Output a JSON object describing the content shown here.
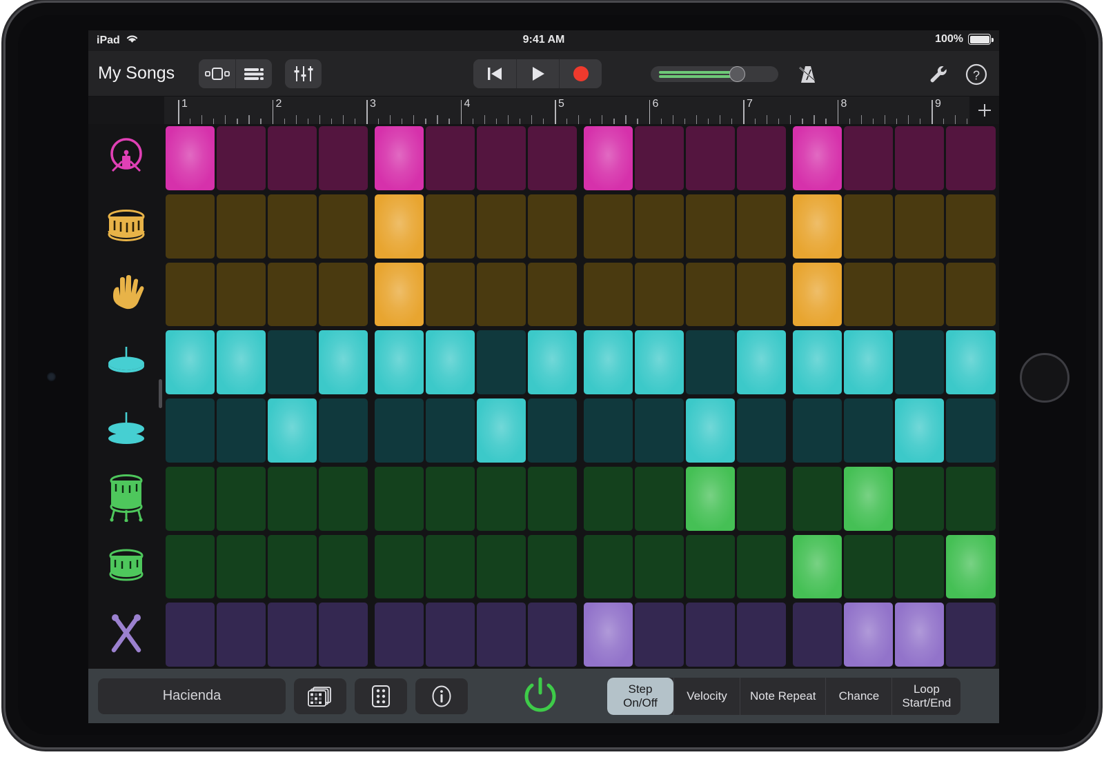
{
  "status_bar": {
    "device_label": "iPad",
    "wifi_icon": "wifi-icon",
    "time": "9:41 AM",
    "battery_percent": "100%"
  },
  "toolbar": {
    "my_songs_label": "My Songs",
    "nav_view_icon": "song-sections-icon",
    "track_view_icon": "track-list-icon",
    "mixer_icon": "mixer-faders-icon",
    "rewind_icon": "rewind-to-start-icon",
    "play_icon": "play-icon",
    "record_icon": "record-icon",
    "metronome_icon": "metronome-icon",
    "settings_icon": "wrench-icon",
    "help_icon": "help-question-icon",
    "volume_value": 74,
    "accent_record": "#ef3a2d",
    "accent_volume": "#6ec977"
  },
  "ruler": {
    "bars": [
      "1",
      "2",
      "3",
      "4",
      "5",
      "6",
      "7",
      "8",
      "9"
    ],
    "add_label": "+"
  },
  "sequencer": {
    "step_count": 16,
    "rows": [
      {
        "name": "kick-drum",
        "icon": "kick-drum-icon",
        "color_on": "#d631ab",
        "color_off": "#54153f",
        "icon_color": "#e040b5",
        "steps": [
          1,
          0,
          0,
          0,
          1,
          0,
          0,
          0,
          1,
          0,
          0,
          0,
          1,
          0,
          0,
          0
        ]
      },
      {
        "name": "snare-drum",
        "icon": "snare-drum-icon",
        "color_on": "#e8a530",
        "color_off": "#4a3a10",
        "icon_color": "#e8b348",
        "steps": [
          0,
          0,
          0,
          0,
          1,
          0,
          0,
          0,
          0,
          0,
          0,
          0,
          1,
          0,
          0,
          0
        ]
      },
      {
        "name": "clap",
        "icon": "hand-clap-icon",
        "color_on": "#e8a530",
        "color_off": "#4a3a10",
        "icon_color": "#e8b348",
        "steps": [
          0,
          0,
          0,
          0,
          1,
          0,
          0,
          0,
          0,
          0,
          0,
          0,
          1,
          0,
          0,
          0
        ]
      },
      {
        "name": "closed-hi-hat",
        "icon": "closed-hihat-icon",
        "color_on": "#3cc9c9",
        "color_off": "#10393d",
        "icon_color": "#46cfd2",
        "steps": [
          1,
          1,
          0,
          1,
          1,
          1,
          0,
          1,
          1,
          1,
          0,
          1,
          1,
          1,
          0,
          1
        ]
      },
      {
        "name": "open-hi-hat",
        "icon": "open-hihat-icon",
        "color_on": "#3cc9c9",
        "color_off": "#10393d",
        "icon_color": "#46cfd2",
        "steps": [
          0,
          0,
          1,
          0,
          0,
          0,
          1,
          0,
          0,
          0,
          1,
          0,
          0,
          0,
          1,
          0
        ]
      },
      {
        "name": "floor-tom",
        "icon": "floor-tom-icon",
        "color_on": "#45c055",
        "color_off": "#14411d",
        "icon_color": "#4ec75c",
        "steps": [
          0,
          0,
          0,
          0,
          0,
          0,
          0,
          0,
          0,
          0,
          1,
          0,
          0,
          1,
          0,
          0
        ]
      },
      {
        "name": "tom",
        "icon": "tom-drum-icon",
        "color_on": "#45c055",
        "color_off": "#14411d",
        "icon_color": "#4ec75c",
        "steps": [
          0,
          0,
          0,
          0,
          0,
          0,
          0,
          0,
          0,
          0,
          0,
          0,
          1,
          0,
          0,
          1
        ]
      },
      {
        "name": "drumsticks",
        "icon": "drumsticks-icon",
        "color_on": "#9273ca",
        "color_off": "#342851",
        "icon_color": "#9b81cf",
        "steps": [
          0,
          0,
          0,
          0,
          0,
          0,
          0,
          0,
          1,
          0,
          0,
          0,
          0,
          1,
          1,
          0
        ]
      }
    ]
  },
  "bottom_bar": {
    "pattern_name": "Hacienda",
    "pattern_browser_icon": "pattern-browser-icon",
    "randomize_icon": "dice-icon",
    "info_icon": "info-icon",
    "power_icon": "power-icon",
    "power_color": "#3ecb49",
    "modes": [
      {
        "label_line1": "Step",
        "label_line2": "On/Off",
        "active": true
      },
      {
        "label_line1": "Velocity",
        "label_line2": "",
        "active": false
      },
      {
        "label_line1": "Note Repeat",
        "label_line2": "",
        "active": false
      },
      {
        "label_line1": "Chance",
        "label_line2": "",
        "active": false
      },
      {
        "label_line1": "Loop",
        "label_line2": "Start/End",
        "active": false
      }
    ]
  }
}
